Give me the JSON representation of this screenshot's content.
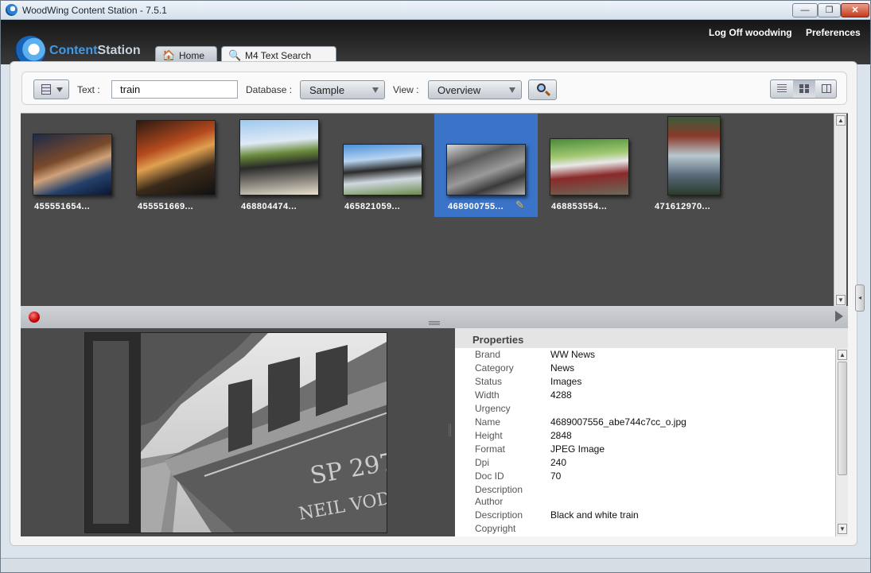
{
  "window": {
    "title": "WoodWing Content Station - 7.5.1",
    "minimize_glyph": "—",
    "maximize_glyph": "❐",
    "close_glyph": "✕"
  },
  "header": {
    "logo_text_a": "Content",
    "logo_text_b": "Station",
    "logoff_label": "Log Off woodwing",
    "preferences_label": "Preferences",
    "tabs": [
      {
        "label": "Home",
        "icon": "house-icon",
        "glyph": "🏠"
      },
      {
        "label": "M4 Text Search",
        "icon": "magnifier-icon",
        "glyph": "🔍"
      }
    ]
  },
  "toolbar": {
    "text_label": "Text :",
    "text_value": "train",
    "database_label": "Database :",
    "database_value": "Sample",
    "view_label": "View :",
    "view_value": "Overview"
  },
  "results": [
    {
      "caption": "455551654...",
      "selected": false
    },
    {
      "caption": "455551669...",
      "selected": false
    },
    {
      "caption": "468804474...",
      "selected": false
    },
    {
      "caption": "465821059...",
      "selected": false
    },
    {
      "caption": "468900755...",
      "selected": true
    },
    {
      "caption": "468853554...",
      "selected": false
    },
    {
      "caption": "471612970...",
      "selected": false
    }
  ],
  "properties": {
    "title": "Properties",
    "rows": [
      {
        "label": "Brand",
        "value": "WW News"
      },
      {
        "label": "Category",
        "value": "News"
      },
      {
        "label": "Status",
        "value": "Images"
      },
      {
        "label": "Width",
        "value": "4288"
      },
      {
        "label": "Urgency",
        "value": ""
      },
      {
        "label": "Name",
        "value": "4689007556_abe744c7cc_o.jpg"
      },
      {
        "label": "Height",
        "value": "2848"
      },
      {
        "label": "Format",
        "value": "JPEG Image"
      },
      {
        "label": "Dpi",
        "value": "240"
      },
      {
        "label": "Doc ID",
        "value": "70"
      },
      {
        "label": "Description Author",
        "value": ""
      },
      {
        "label": "Description",
        "value": "Black and white train"
      },
      {
        "label": "Copyright",
        "value": ""
      }
    ]
  },
  "colors": {
    "accent": "#3a73c8",
    "logo_blue": "#3f9ae8",
    "grid_bg": "#4b4b4b",
    "record": "#c40000"
  }
}
